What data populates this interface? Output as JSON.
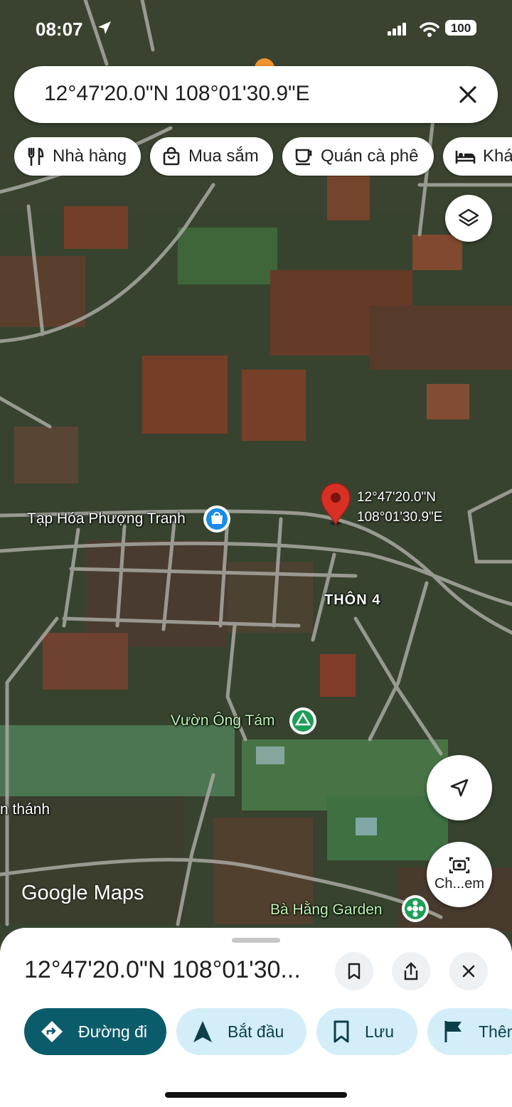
{
  "status_bar": {
    "time": "08:07",
    "battery": "100"
  },
  "search": {
    "query": "12°47'20.0\"N 108°01'30.9\"E"
  },
  "chips": [
    {
      "label": "Nhà hàng",
      "icon": "restaurant-icon"
    },
    {
      "label": "Mua sắm",
      "icon": "shopping-bag-icon"
    },
    {
      "label": "Quán cà phê",
      "icon": "coffee-icon"
    },
    {
      "label": "Khác",
      "icon": "bed-icon"
    }
  ],
  "map": {
    "pin_label_line1": "12°47'20.0\"N",
    "pin_label_line2": "108°01'30.9\"E",
    "labels": {
      "shop": "Tạp Hóa Phượng Tranh",
      "village": "THÔN 4",
      "garden1": "Vườn Ông Tám",
      "church": "n thánh",
      "garden2": "Bà Hằng Garden"
    },
    "attribution": "Google Maps",
    "lens_label": "Ch...em"
  },
  "sheet": {
    "title": "12°47'20.0\"N 108°01'30...",
    "actions": [
      {
        "label": "Đường đi",
        "icon": "directions-icon"
      },
      {
        "label": "Bắt đầu",
        "icon": "navigation-arrow-icon"
      },
      {
        "label": "Lưu",
        "icon": "bookmark-icon"
      },
      {
        "label": "Thêm",
        "icon": "flag-icon"
      }
    ]
  },
  "colors": {
    "primary": "#0b5c6b",
    "chip_bg": "#d3eef8",
    "pin": "#d93025",
    "text": "#1f1f1f"
  }
}
